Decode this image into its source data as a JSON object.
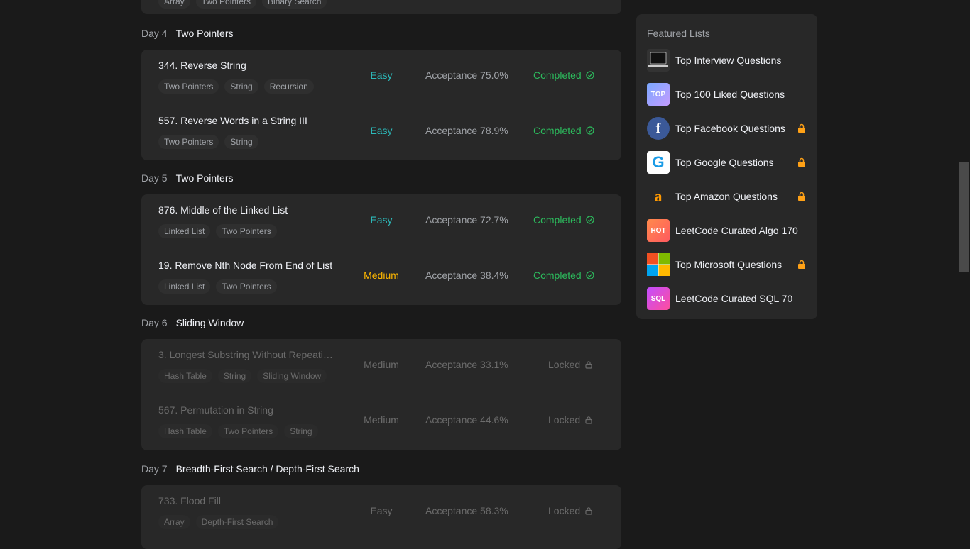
{
  "prev_card_tags": [
    "Array",
    "Two Pointers",
    "Binary Search"
  ],
  "days": [
    {
      "label": "Day 4",
      "topic": "Two Pointers",
      "problems": [
        {
          "title": "344. Reverse String",
          "tags": [
            "Two Pointers",
            "String",
            "Recursion"
          ],
          "difficulty": "Easy",
          "acceptance": "Acceptance 75.0%",
          "status": "Completed"
        },
        {
          "title": "557. Reverse Words in a String III",
          "tags": [
            "Two Pointers",
            "String"
          ],
          "difficulty": "Easy",
          "acceptance": "Acceptance 78.9%",
          "status": "Completed"
        }
      ]
    },
    {
      "label": "Day 5",
      "topic": "Two Pointers",
      "problems": [
        {
          "title": "876. Middle of the Linked List",
          "tags": [
            "Linked List",
            "Two Pointers"
          ],
          "difficulty": "Easy",
          "acceptance": "Acceptance 72.7%",
          "status": "Completed"
        },
        {
          "title": "19. Remove Nth Node From End of List",
          "tags": [
            "Linked List",
            "Two Pointers"
          ],
          "difficulty": "Medium",
          "acceptance": "Acceptance 38.4%",
          "status": "Completed"
        }
      ]
    },
    {
      "label": "Day 6",
      "topic": "Sliding Window",
      "problems": [
        {
          "title": "3. Longest Substring Without Repeatin...",
          "tags": [
            "Hash Table",
            "String",
            "Sliding Window"
          ],
          "difficulty": "Medium",
          "acceptance": "Acceptance 33.1%",
          "status": "Locked"
        },
        {
          "title": "567. Permutation in String",
          "tags": [
            "Hash Table",
            "Two Pointers",
            "String"
          ],
          "difficulty": "Medium",
          "acceptance": "Acceptance 44.6%",
          "status": "Locked"
        }
      ]
    },
    {
      "label": "Day 7",
      "topic": "Breadth-First Search / Depth-First Search",
      "problems": [
        {
          "title": "733. Flood Fill",
          "tags": [
            "Array",
            "Depth-First Search"
          ],
          "difficulty": "Easy",
          "acceptance": "Acceptance 58.3%",
          "status": "Locked"
        }
      ]
    }
  ],
  "sidebar": {
    "title": "Featured Lists",
    "items": [
      {
        "label": "Top Interview Questions",
        "thumb": "laptop",
        "locked": false
      },
      {
        "label": "Top 100 Liked Questions",
        "thumb": "TOP",
        "locked": false
      },
      {
        "label": "Top Facebook Questions",
        "thumb": "f",
        "locked": true
      },
      {
        "label": "Top Google Questions",
        "thumb": "G",
        "locked": true
      },
      {
        "label": "Top Amazon Questions",
        "thumb": "a",
        "locked": true
      },
      {
        "label": "LeetCode Curated Algo 170",
        "thumb": "HOT",
        "locked": false
      },
      {
        "label": "Top Microsoft Questions",
        "thumb": "microsoft",
        "locked": true
      },
      {
        "label": "LeetCode Curated SQL 70",
        "thumb": "SQL",
        "locked": false
      }
    ]
  },
  "colors": {
    "easy": "#2cbbbb",
    "medium": "#ffb800",
    "completed": "#2cbb5d",
    "locked": "#6b6b6b",
    "lock_gold": "#ffa116"
  }
}
